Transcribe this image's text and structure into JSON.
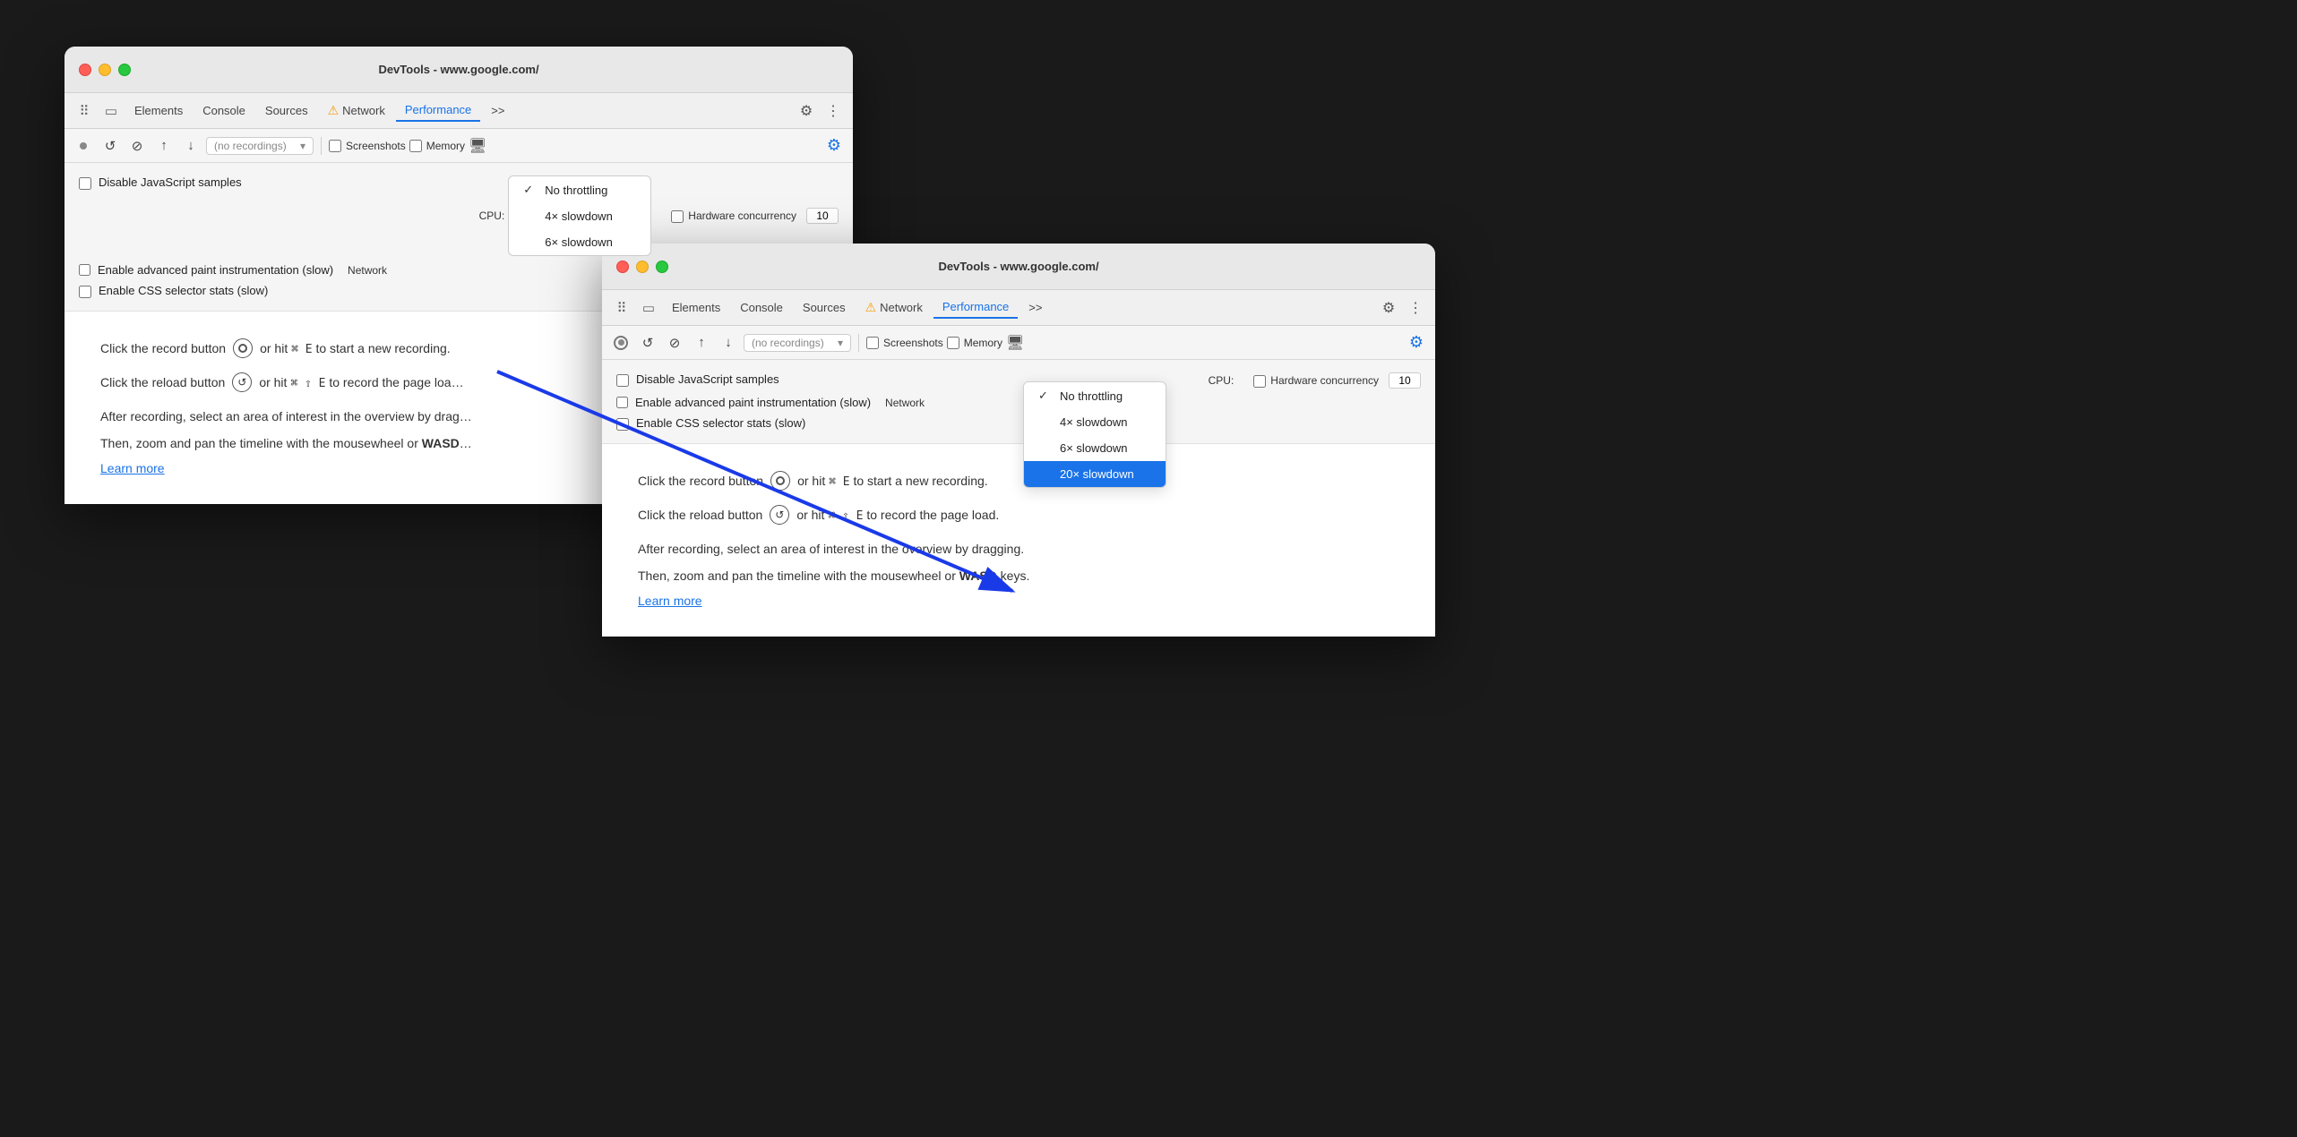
{
  "window1": {
    "title": "DevTools - www.google.com/",
    "tabs": [
      "Elements",
      "Console",
      "Sources",
      "Network",
      "Performance",
      ">>"
    ],
    "toolbar": {
      "recordings_placeholder": "(no recordings)",
      "screenshots_label": "Screenshots",
      "memory_label": "Memory"
    },
    "settings": {
      "disable_js": "Disable JavaScript samples",
      "advanced_paint": "Enable advanced paint instrumentation (slow)",
      "css_selector": "Enable CSS selector stats (slow)",
      "cpu_label": "CPU:",
      "network_label": "Network",
      "hardware_label": "Hardware concurrency",
      "concurrency_value": "10"
    },
    "content": {
      "record_text": "Click the record button",
      "record_suffix": "or hit ⌘ E to start a new recording.",
      "reload_text": "Click the reload button",
      "reload_suffix": "or hit ⌘ ⇧ E to record the page load.",
      "after_text": "After recording, select an area of interest in the overview by dragging.",
      "after_text2": "Then, zoom and pan the timeline with the mousewheel or WASD keys.",
      "learn_more": "Learn more"
    },
    "dropdown": {
      "items": [
        {
          "label": "No throttling",
          "checked": true
        },
        {
          "label": "4× slowdown",
          "checked": false
        },
        {
          "label": "6× slowdown",
          "checked": false
        }
      ]
    }
  },
  "window2": {
    "title": "DevTools - www.google.com/",
    "tabs": [
      "Elements",
      "Console",
      "Sources",
      "Network",
      "Performance",
      ">>"
    ],
    "toolbar": {
      "recordings_placeholder": "(no recordings)",
      "screenshots_label": "Screenshots",
      "memory_label": "Memory"
    },
    "settings": {
      "disable_js": "Disable JavaScript samples",
      "advanced_paint": "Enable advanced paint instrumentation (slow)",
      "css_selector": "Enable CSS selector stats (slow)",
      "cpu_label": "CPU:",
      "network_label": "Network",
      "hardware_label": "Hardware concurrency",
      "concurrency_value": "10"
    },
    "content": {
      "record_text": "Click the record button",
      "record_suffix": "or hit ⌘ E to start a new recording.",
      "reload_text": "Click the reload button",
      "reload_suffix": "or hit ⌘ ⇧ E to record the page load.",
      "after_text": "After recording, select an area of interest in the overview by dragging.",
      "after_text2": "Then, zoom and pan the timeline with the mousewheel or WASD keys.",
      "learn_more": "Learn more"
    },
    "dropdown": {
      "items": [
        {
          "label": "No throttling",
          "checked": true,
          "highlighted": false
        },
        {
          "label": "4× slowdown",
          "checked": false,
          "highlighted": false
        },
        {
          "label": "6× slowdown",
          "checked": false,
          "highlighted": false
        },
        {
          "label": "20× slowdown",
          "checked": false,
          "highlighted": true
        }
      ]
    }
  },
  "arrow": {
    "description": "Arrow pointing from window1 dropdown to window2 20x slowdown"
  }
}
